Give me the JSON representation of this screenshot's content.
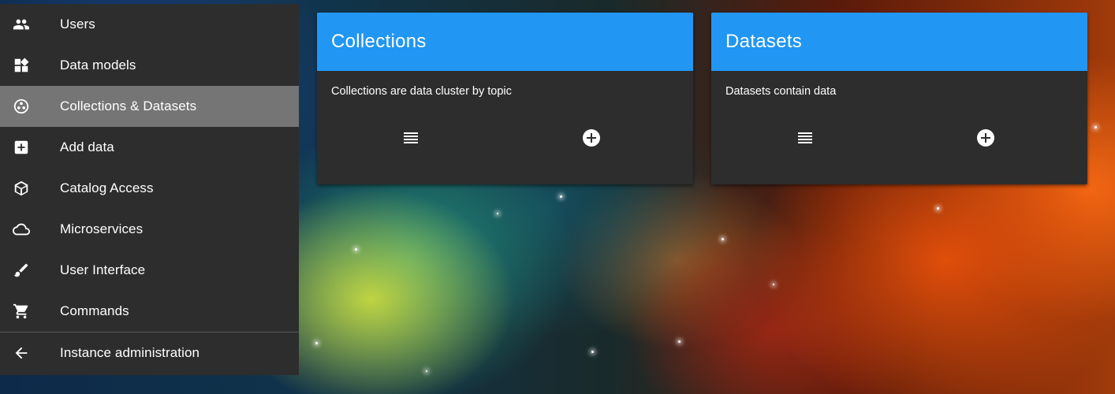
{
  "sidebar": {
    "items": [
      {
        "label": "Users",
        "icon": "users-icon",
        "active": false
      },
      {
        "label": "Data models",
        "icon": "widgets-icon",
        "active": false
      },
      {
        "label": "Collections & Datasets",
        "icon": "collections-icon",
        "active": true
      },
      {
        "label": "Add data",
        "icon": "add-box-icon",
        "active": false
      },
      {
        "label": "Catalog Access",
        "icon": "cube-icon",
        "active": false
      },
      {
        "label": "Microservices",
        "icon": "cloud-icon",
        "active": false
      },
      {
        "label": "User Interface",
        "icon": "brush-icon",
        "active": false
      },
      {
        "label": "Commands",
        "icon": "cart-icon",
        "active": false
      },
      {
        "label": "Instance administration",
        "icon": "arrow-back-icon",
        "active": false
      }
    ]
  },
  "cards": [
    {
      "title": "Collections",
      "description": "Collections are data cluster by topic",
      "list_icon": "list-icon",
      "add_icon": "add-circle-icon"
    },
    {
      "title": "Datasets",
      "description": "Datasets contain data",
      "list_icon": "list-icon",
      "add_icon": "add-circle-icon"
    }
  ],
  "colors": {
    "sidebar_bg": "#2d2d2d",
    "sidebar_active": "#757575",
    "card_header": "#2196f3",
    "card_body": "#2d2d2d"
  }
}
